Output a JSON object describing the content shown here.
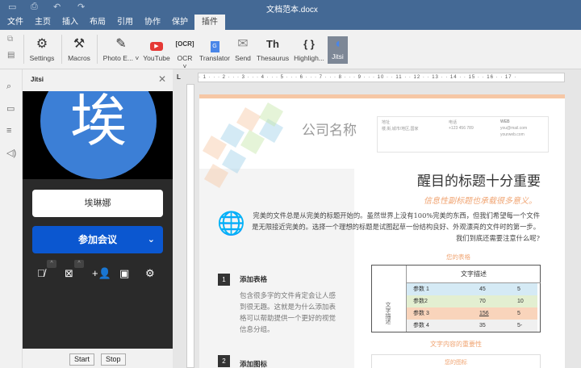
{
  "window": {
    "title": "文档范本.docx"
  },
  "menu": [
    "文件",
    "主页",
    "插入",
    "布局",
    "引用",
    "协作",
    "保护",
    "插件"
  ],
  "toolbar": [
    "Settings",
    "Macros",
    "Photo E...",
    "YouTube",
    "OCR",
    "Translator",
    "Send",
    "Thesaurus",
    "Highligh...",
    "Jitsi"
  ],
  "toolbar_glyphs": {
    "thesaurus": "Th",
    "highlight": "{ }"
  },
  "panel": {
    "title": "Jitsi",
    "avatar_letter": "埃",
    "name": "埃琳娜",
    "join": "参加会议",
    "start": "Start",
    "stop": "Stop"
  },
  "doc": {
    "company": "公司名称",
    "info": {
      "addr_label": "地址",
      "addr": "楼,街,城市/地区,国家",
      "phone_label": "电话",
      "phone": "+123 456 789",
      "web_label": "WEB",
      "email": "you@mail.com",
      "web": "yourweb.com"
    },
    "headline": "醒目的标题十分重要",
    "subhead": "信息性副标题也承载很多意义。",
    "body": "完美的文件总是从完美的标题开始的。虽然世界上没有100%完美的东西，但我们希望每一个文件是无限接近完美的。选择一个理想的标题是试图起草一份结构良好、外观漂亮的文件时的第一步。我们到底还需要注意什么呢?",
    "sec1_num": "1",
    "sec1_title": "添加表格",
    "sec1_text": "包含很多字的文件肯定会让人感到很无趣。这就是为什么添加表格可以帮助提供一个更好的视觉信息分组。",
    "sec2_num": "2",
    "sec2_title": "添加图标",
    "table_caption": "您的表格",
    "table_header": "文字描述",
    "table_side": "文字描述",
    "table_rows": [
      [
        "参数 1",
        "45",
        "5"
      ],
      [
        "参数2",
        "70",
        "10"
      ],
      [
        "参数 3",
        "156",
        "5"
      ],
      [
        "参数 4",
        "35",
        "5-"
      ]
    ],
    "caption2": "文字内容的重要性",
    "chart_caption": "您的图标"
  },
  "colors": {
    "accent": "#446995",
    "orange": "#f0a472",
    "join": "#0b57d0"
  }
}
